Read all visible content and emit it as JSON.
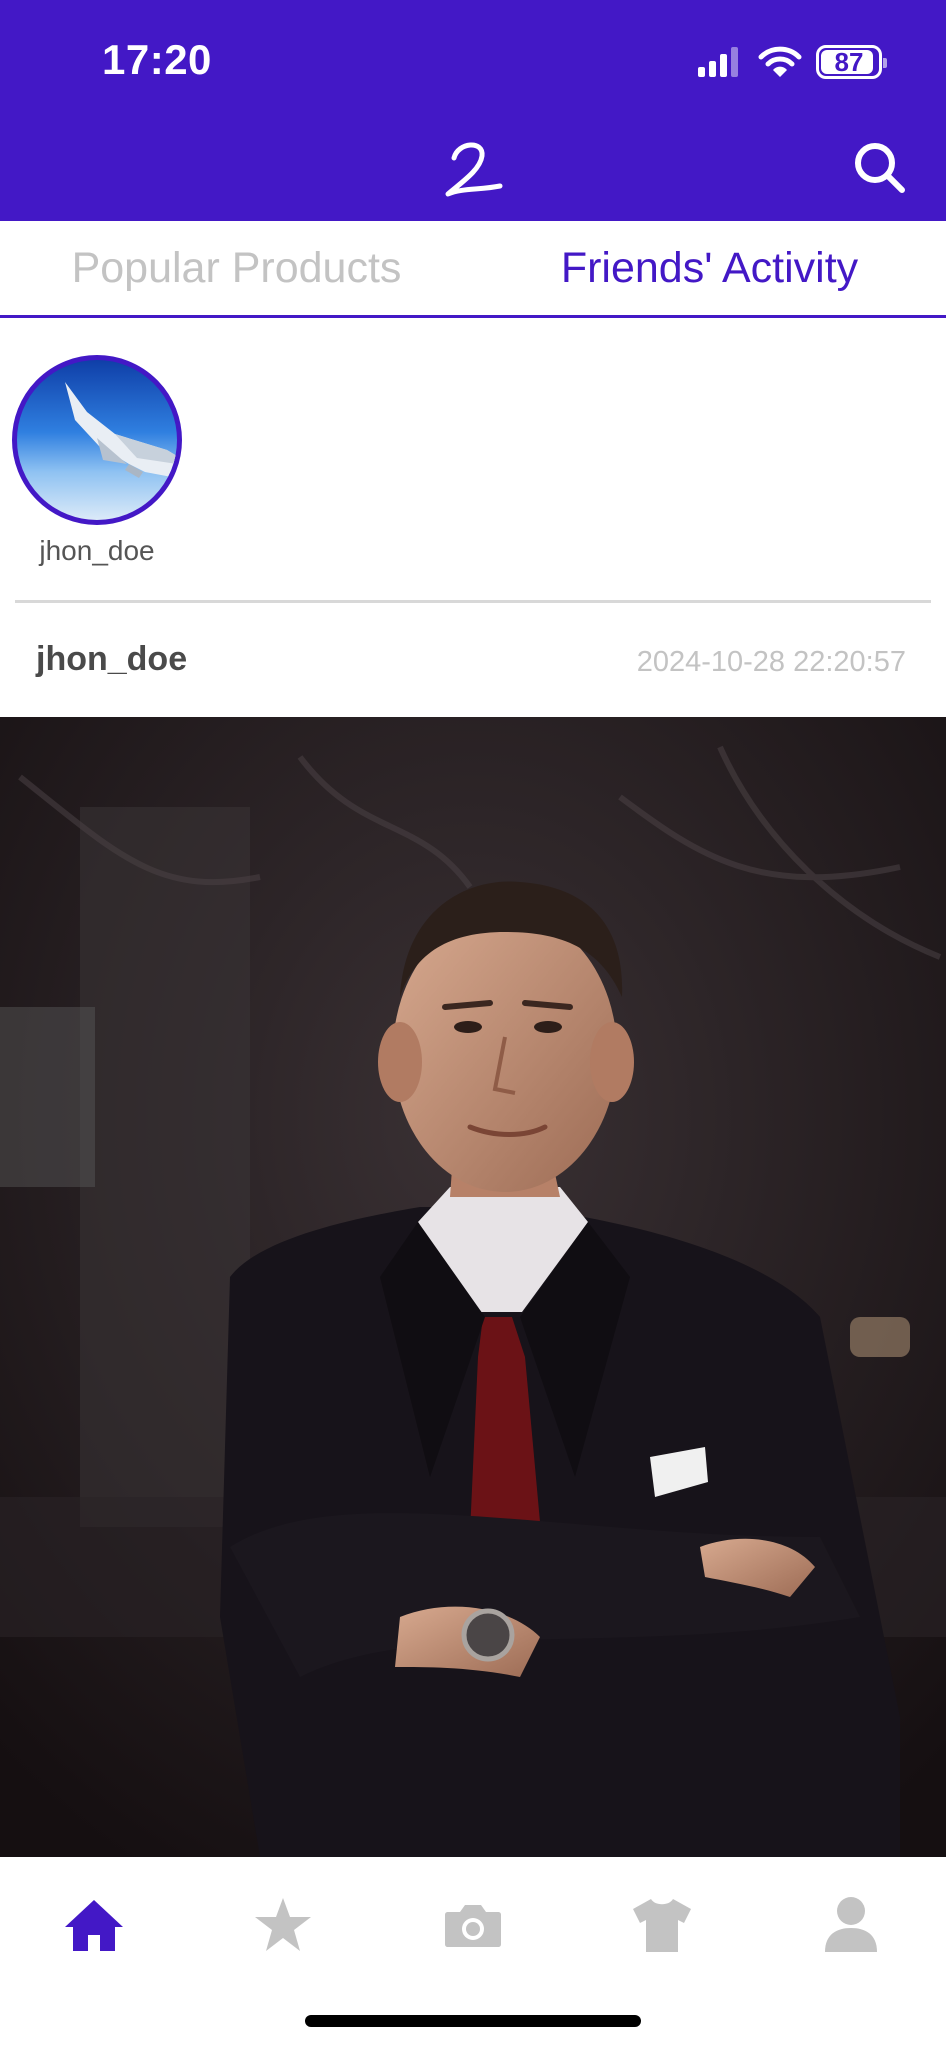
{
  "status_bar": {
    "time": "17:20",
    "battery": "87"
  },
  "header": {
    "logo_icon": "logo-icon",
    "search_icon": "search-icon"
  },
  "tabs": [
    {
      "label": "Popular Products",
      "active": false
    },
    {
      "label": "Friends' Activity",
      "active": true
    }
  ],
  "stories": [
    {
      "username": "jhon_doe",
      "avatar_icon": "airplane-wing-avatar"
    }
  ],
  "post": {
    "username": "jhon_doe",
    "timestamp": "2024-10-28 22:20:57",
    "image": "man-in-suit-photo"
  },
  "bottom_nav": [
    {
      "icon": "home-icon",
      "active": true
    },
    {
      "icon": "star-icon",
      "active": false
    },
    {
      "icon": "camera-icon",
      "active": false
    },
    {
      "icon": "tshirt-icon",
      "active": false
    },
    {
      "icon": "profile-icon",
      "active": false
    }
  ],
  "colors": {
    "accent": "#4318c6",
    "inactive": "#c3c3c3",
    "text": "#4a4a4a"
  }
}
